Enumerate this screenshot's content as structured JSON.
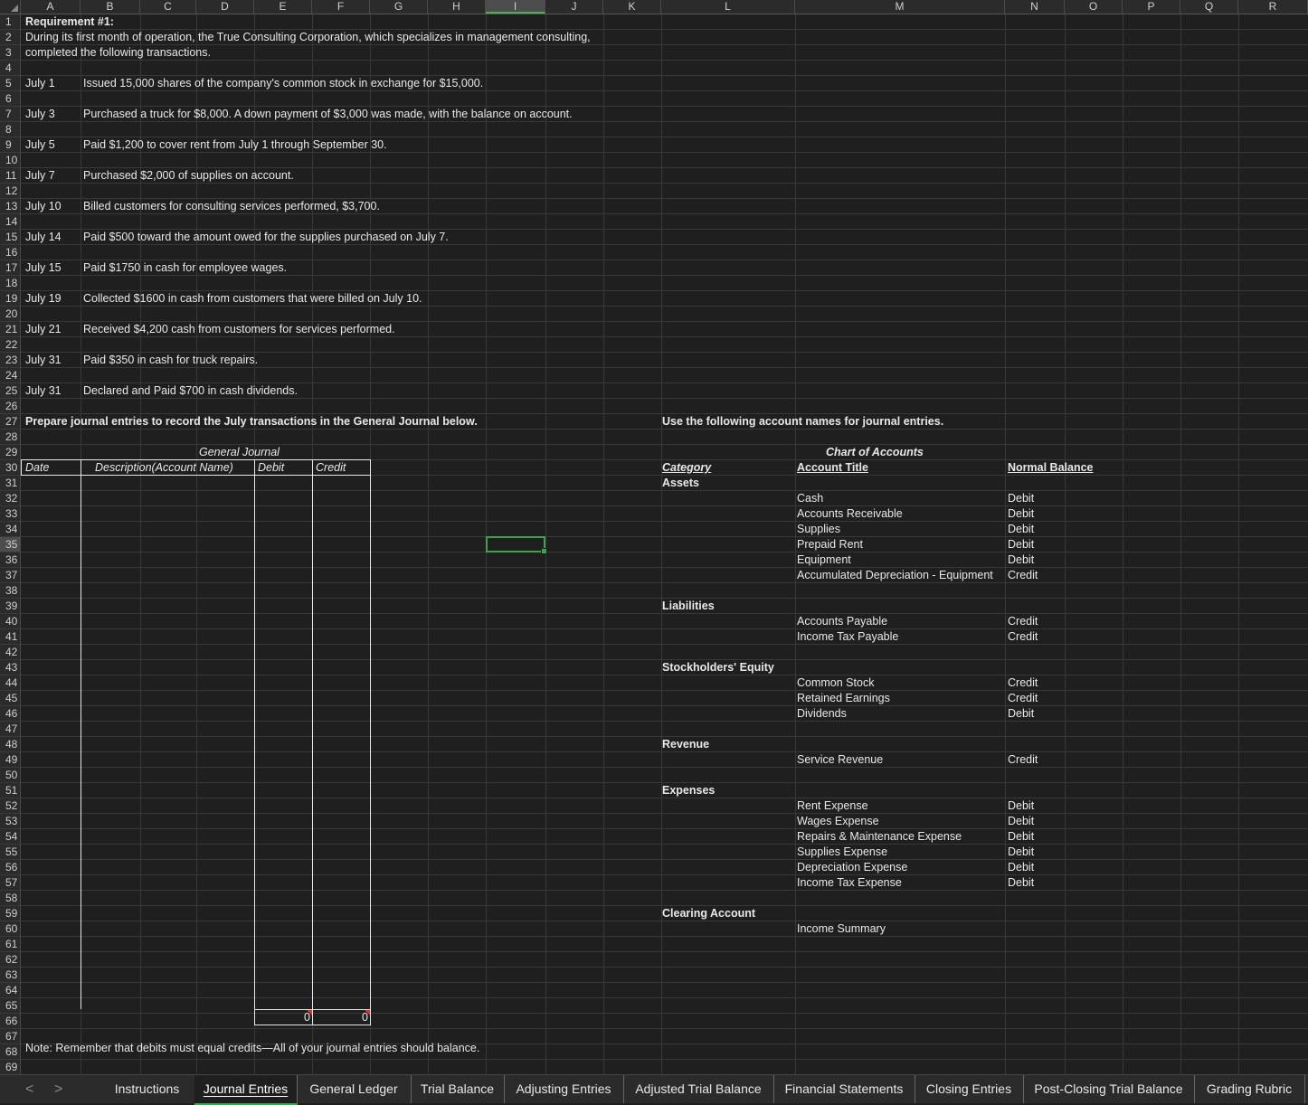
{
  "columns": [
    "A",
    "B",
    "C",
    "D",
    "E",
    "F",
    "G",
    "H",
    "I",
    "J",
    "K",
    "L",
    "M",
    "N",
    "O",
    "P",
    "Q",
    "R"
  ],
  "rows": [
    "1",
    "2",
    "3",
    "4",
    "5",
    "6",
    "7",
    "8",
    "9",
    "10",
    "11",
    "12",
    "13",
    "14",
    "15",
    "16",
    "17",
    "18",
    "19",
    "20",
    "21",
    "22",
    "23",
    "24",
    "25",
    "26",
    "27",
    "28",
    "29",
    "30",
    "31",
    "32",
    "33",
    "34",
    "35",
    "36",
    "37",
    "38",
    "39",
    "40",
    "41",
    "42",
    "43",
    "44",
    "45",
    "46",
    "47",
    "48",
    "49",
    "50",
    "51",
    "52",
    "53",
    "54",
    "55",
    "56",
    "57",
    "58",
    "59",
    "60",
    "61",
    "62",
    "63",
    "64",
    "65",
    "66",
    "67",
    "68",
    "69"
  ],
  "requirement_title": "Requirement #1:",
  "intro_line1": "During its first month of operation, the True Consulting Corporation, which specializes in management consulting,",
  "intro_line2": "completed the following transactions.",
  "transactions": [
    {
      "date": "July 1",
      "text": "Issued 15,000 shares of the company's common stock in exchange for $15,000."
    },
    {
      "date": "July 3",
      "text": "Purchased a truck for $8,000. A down payment of $3,000 was made, with the balance on account."
    },
    {
      "date": "July 5",
      "text": "Paid $1,200 to cover rent from July 1 through September 30."
    },
    {
      "date": "July 7",
      "text": "Purchased $2,000 of supplies on account."
    },
    {
      "date": "July 10",
      "text": "Billed customers for consulting services performed, $3,700."
    },
    {
      "date": "July 14",
      "text": "Paid $500 toward the amount owed for the supplies purchased on July 7."
    },
    {
      "date": "July 15",
      "text": "Paid $1750 in cash for employee wages."
    },
    {
      "date": "July 19",
      "text": "Collected $1600 in cash from customers that were billed on July 10."
    },
    {
      "date": "July 21",
      "text": "Received $4,200 cash from customers for services performed."
    },
    {
      "date": "July 31",
      "text": "Paid $350 in cash for truck repairs."
    },
    {
      "date": "July 31",
      "text": "Declared and Paid  $700 in cash dividends."
    }
  ],
  "prepare_text": "Prepare journal entries to record the July transactions in the General Journal below.",
  "use_names_text": "Use the following account names for journal entries.",
  "journal": {
    "title": "General Journal",
    "headers": {
      "date": "Date",
      "description": "Description(Account Name)",
      "debit": "Debit",
      "credit": "Credit"
    },
    "total_debit": "0",
    "total_credit": "0"
  },
  "chart_of_accounts": {
    "title": "Chart of Accounts",
    "header_category": "Category",
    "header_account": "Account Title",
    "header_normal": "Normal Balance",
    "assets_label": "Assets",
    "assets": [
      {
        "name": "Cash",
        "normal": "Debit"
      },
      {
        "name": "Accounts Receivable",
        "normal": "Debit"
      },
      {
        "name": "Supplies",
        "normal": "Debit"
      },
      {
        "name": "Prepaid Rent",
        "normal": "Debit"
      },
      {
        "name": "Equipment",
        "normal": "Debit"
      },
      {
        "name": "Accumulated Depreciation - Equipment",
        "normal": "Credit"
      }
    ],
    "liabilities_label": "Liabilities",
    "liabilities": [
      {
        "name": "Accounts Payable",
        "normal": "Credit"
      },
      {
        "name": "Income Tax Payable",
        "normal": "Credit"
      }
    ],
    "equity_label": "Stockholders' Equity",
    "equity": [
      {
        "name": "Common Stock",
        "normal": "Credit"
      },
      {
        "name": "Retained Earnings",
        "normal": "Credit"
      },
      {
        "name": "Dividends",
        "normal": "Debit"
      }
    ],
    "revenue_label": "Revenue",
    "revenue": [
      {
        "name": "Service Revenue",
        "normal": "Credit"
      }
    ],
    "expenses_label": "Expenses",
    "expenses": [
      {
        "name": "Rent Expense",
        "normal": "Debit"
      },
      {
        "name": "Wages Expense",
        "normal": "Debit"
      },
      {
        "name": "Repairs & Maintenance Expense",
        "normal": "Debit"
      },
      {
        "name": "Supplies Expense",
        "normal": "Debit"
      },
      {
        "name": "Depreciation Expense",
        "normal": "Debit"
      },
      {
        "name": "Income Tax Expense",
        "normal": "Debit"
      }
    ],
    "clearing_label": "Clearing Account",
    "clearing": [
      {
        "name": "Income Summary",
        "normal": ""
      }
    ]
  },
  "note": "Note: Remember that debits must equal credits—All of your journal entries should balance.",
  "sheet_tabs": [
    "Instructions",
    "Journal Entries",
    "General Ledger",
    "Trial Balance",
    "Adjusting Entries",
    "Adjusted Trial Balance",
    "Financial Statements",
    "Closing Entries",
    "Post-Closing Trial Balance",
    "Grading Rubric"
  ],
  "active_tab": "Journal Entries",
  "nav": {
    "prev": "<",
    "next": ">"
  },
  "colors": {
    "background": "#1f1f1f",
    "selection": "#3fa34d",
    "error_marker": "#e03030"
  }
}
